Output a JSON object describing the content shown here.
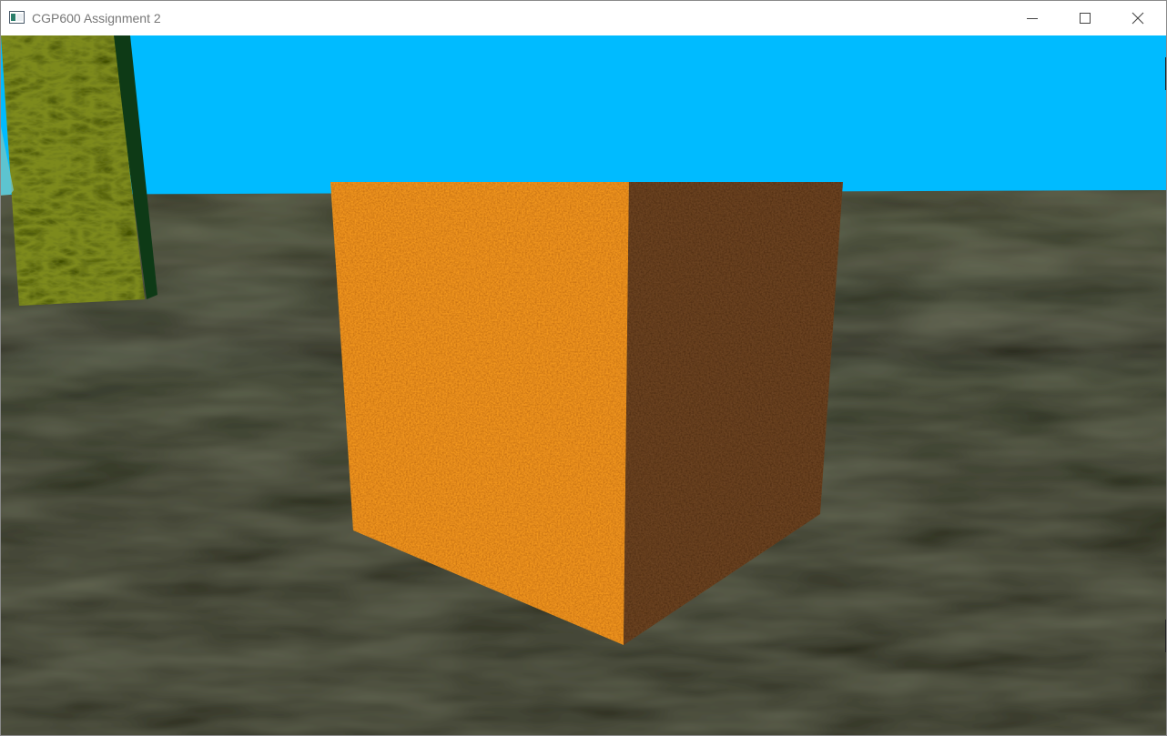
{
  "window": {
    "title": "CGP600 Assignment 2",
    "controls": {
      "minimize_icon": "minimize-icon",
      "maximize_icon": "maximize-icon",
      "close_icon": "close-icon"
    }
  },
  "scene": {
    "objects": [
      "sky",
      "ground",
      "textured-cube",
      "grass-textured-panel"
    ],
    "colors": {
      "sky": "#00bbff",
      "ground": "#1d1f0f",
      "cube_lit_face": "#f0951e",
      "cube_shadow_face": "#6b4220",
      "grass_panel": "#7d8a1e"
    }
  }
}
